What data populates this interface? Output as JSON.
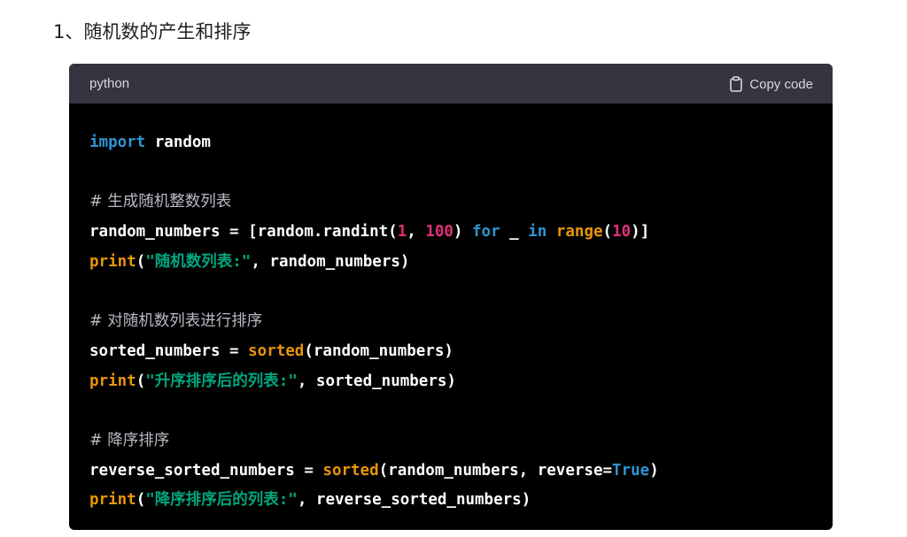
{
  "heading": "1、随机数的产生和排序",
  "code_block": {
    "language": "python",
    "copy_label": "Copy code",
    "colors": {
      "header_bg": "#343541",
      "body_bg": "#000000",
      "keyword": "#2e95d3",
      "builtin": "#e9950c",
      "number": "#df3079",
      "string": "#00a67d",
      "comment": "#b9b9c4"
    },
    "lines": [
      [
        {
          "t": "import",
          "c": "keyword"
        },
        {
          "t": " random",
          "c": "plain"
        }
      ],
      [],
      [
        {
          "t": "# 生成随机整数列表",
          "c": "comment"
        }
      ],
      [
        {
          "t": "random_numbers = [random.randint(",
          "c": "plain"
        },
        {
          "t": "1",
          "c": "number"
        },
        {
          "t": ", ",
          "c": "plain"
        },
        {
          "t": "100",
          "c": "number"
        },
        {
          "t": ") ",
          "c": "plain"
        },
        {
          "t": "for",
          "c": "keyword"
        },
        {
          "t": " _ ",
          "c": "plain"
        },
        {
          "t": "in",
          "c": "keyword"
        },
        {
          "t": " ",
          "c": "plain"
        },
        {
          "t": "range",
          "c": "builtin"
        },
        {
          "t": "(",
          "c": "plain"
        },
        {
          "t": "10",
          "c": "number"
        },
        {
          "t": ")]",
          "c": "plain"
        }
      ],
      [
        {
          "t": "print",
          "c": "builtin"
        },
        {
          "t": "(",
          "c": "plain"
        },
        {
          "t": "\"随机数列表:\"",
          "c": "string"
        },
        {
          "t": ", random_numbers)",
          "c": "plain"
        }
      ],
      [],
      [
        {
          "t": "# 对随机数列表进行排序",
          "c": "comment"
        }
      ],
      [
        {
          "t": "sorted_numbers = ",
          "c": "plain"
        },
        {
          "t": "sorted",
          "c": "builtin"
        },
        {
          "t": "(random_numbers)",
          "c": "plain"
        }
      ],
      [
        {
          "t": "print",
          "c": "builtin"
        },
        {
          "t": "(",
          "c": "plain"
        },
        {
          "t": "\"升序排序后的列表:\"",
          "c": "string"
        },
        {
          "t": ", sorted_numbers)",
          "c": "plain"
        }
      ],
      [],
      [
        {
          "t": "# 降序排序",
          "c": "comment"
        }
      ],
      [
        {
          "t": "reverse_sorted_numbers = ",
          "c": "plain"
        },
        {
          "t": "sorted",
          "c": "builtin"
        },
        {
          "t": "(random_numbers, reverse=",
          "c": "plain"
        },
        {
          "t": "True",
          "c": "const"
        },
        {
          "t": ")",
          "c": "plain"
        }
      ],
      [
        {
          "t": "print",
          "c": "builtin"
        },
        {
          "t": "(",
          "c": "plain"
        },
        {
          "t": "\"降序排序后的列表:\"",
          "c": "string"
        },
        {
          "t": ", reverse_sorted_numbers)",
          "c": "plain"
        }
      ]
    ]
  }
}
